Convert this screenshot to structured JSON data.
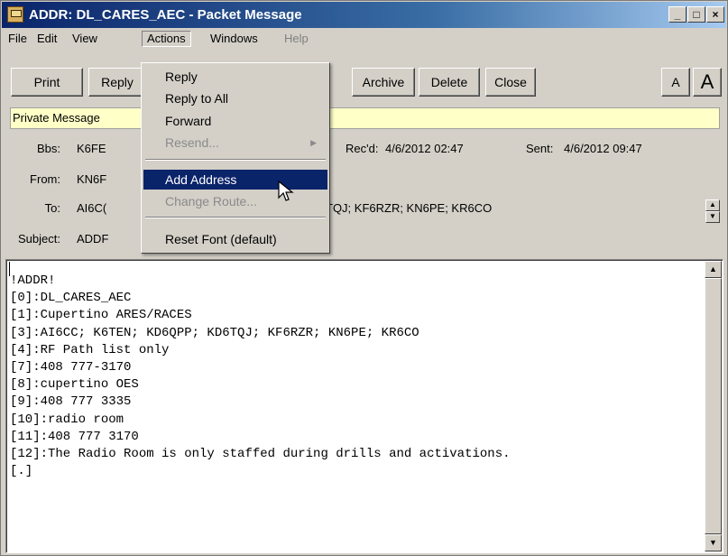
{
  "window": {
    "title": "ADDR: DL_CARES_AEC - Packet Message",
    "min_glyph": "_",
    "max_glyph": "□",
    "close_glyph": "×"
  },
  "menubar": {
    "items": [
      {
        "label": "File"
      },
      {
        "label": "Edit"
      },
      {
        "label": "View"
      },
      {
        "label": "Actions"
      },
      {
        "label": "Windows"
      },
      {
        "label": "Help"
      }
    ]
  },
  "toolbar": {
    "print": "Print",
    "reply": "Reply",
    "archive": "Archive",
    "delete": "Delete",
    "close": "Close",
    "font_small": "A",
    "font_large": "A"
  },
  "private_label": "Private Message",
  "header": {
    "bbs_label": "Bbs:",
    "bbs_value": "K6FE",
    "recd_label": "Rec'd:",
    "recd_value": "4/6/2012 02:47",
    "sent_label": "Sent:",
    "sent_value": "4/6/2012 09:47",
    "from_label": "From:",
    "from_value": "KN6F",
    "to_label": "To:",
    "to_value_left": "AI6C(",
    "to_value_right": "TQJ; KF6RZR; KN6PE; KR6CO",
    "subject_label": "Subject:",
    "subject_value": "ADDF"
  },
  "body": {
    "text": "!ADDR!\n[0]:DL_CARES_AEC\n[1]:Cupertino ARES/RACES\n[3]:AI6CC; K6TEN; KD6QPP; KD6TQJ; KF6RZR; KN6PE; KR6CO\n[4]:RF Path list only\n[7]:408 777-3170\n[8]:cupertino OES\n[9]:408 777 3335\n[10]:radio room\n[11]:408 777 3170\n[12]:The Radio Room is only staffed during drills and activations.\n[.]"
  },
  "actions_menu": {
    "items": [
      {
        "label": "Reply",
        "enabled": true
      },
      {
        "label": "Reply to All",
        "enabled": true
      },
      {
        "label": "Forward",
        "enabled": true
      },
      {
        "label": "Resend...",
        "enabled": false,
        "submenu": true
      },
      {
        "label": "Add Address",
        "enabled": true,
        "highlighted": true
      },
      {
        "label": "Change Route...",
        "enabled": false
      },
      {
        "label": "Reset Font (default)",
        "enabled": true
      }
    ]
  },
  "colors": {
    "titlebar": "#0a246a",
    "highlight": "#0a246a",
    "private_bar": "#ffffc8",
    "chrome": "#d4d0c8"
  },
  "icons": [
    "app-icon",
    "minimize-icon",
    "maximize-icon",
    "close-icon",
    "submenu-arrow-icon",
    "mouse-pointer-icon",
    "scroll-up-icon",
    "scroll-down-icon"
  ]
}
